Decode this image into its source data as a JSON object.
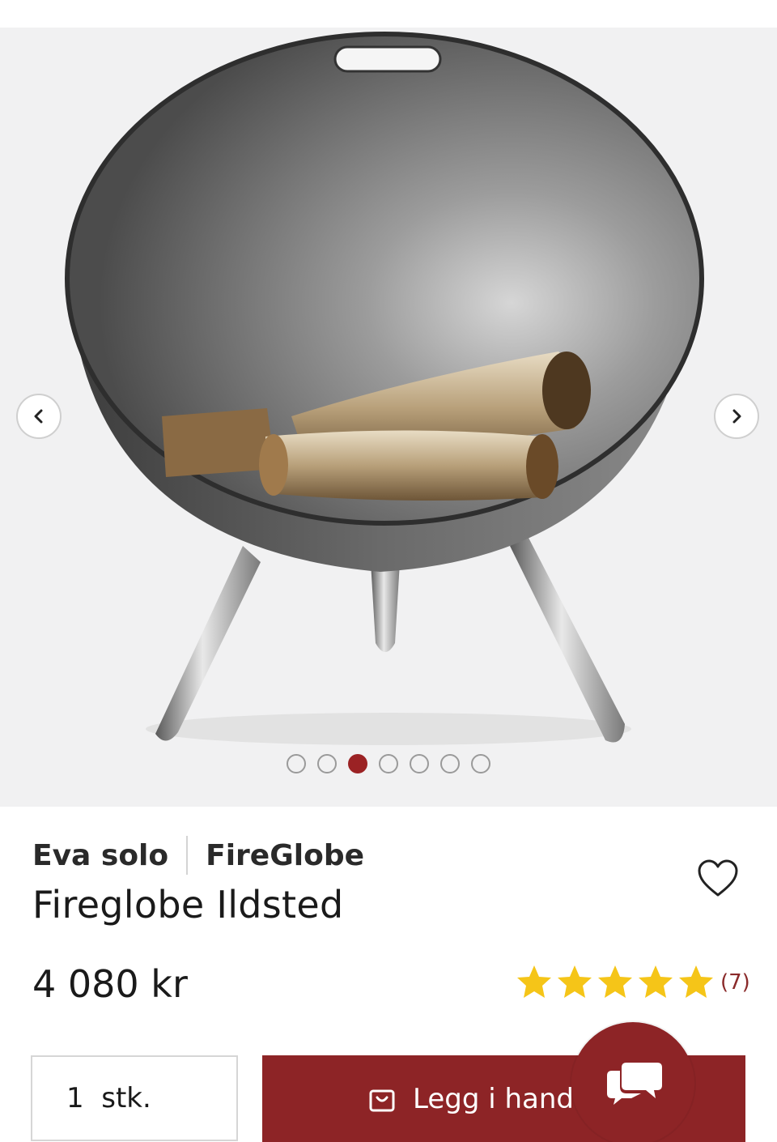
{
  "gallery": {
    "image_alt": "Fireglobe Ildsted",
    "prev_icon": "chevron-left-icon",
    "next_icon": "chevron-right-icon",
    "slide_count": 7,
    "active_slide": 3
  },
  "product": {
    "brand": "Eva solo",
    "series": "FireGlobe",
    "title": "Fireglobe Ildsted",
    "price": "4 080 kr",
    "rating": 5,
    "rating_max": 5,
    "review_count": "(7)"
  },
  "purchase": {
    "quantity_label": "1  stk.",
    "add_to_cart_label": "Legg i handlekurv",
    "cart_icon": "shopping-bag-icon"
  },
  "chat": {
    "icon": "chat-bubbles-icon"
  },
  "colors": {
    "accent": "#8d2426",
    "dot_active": "#9b2224",
    "star": "#f5c518",
    "gallery_bg": "#f1f1f2"
  }
}
